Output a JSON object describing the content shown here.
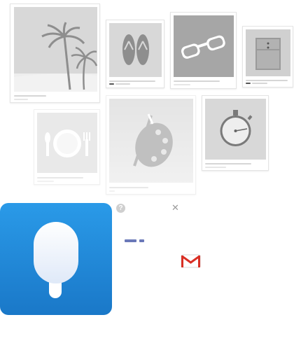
{
  "app": {
    "name": "Popsicle",
    "tile_color_top": "#2a9ae8",
    "tile_color_bottom": "#1a78c8",
    "icon": "popsicle-icon"
  },
  "popup": {
    "help_label": "?",
    "close_label": "✕",
    "help_icon": "question-circle-icon",
    "close_icon": "close-icon",
    "progress_color": "#6a78b8",
    "share_target": "gmail-icon"
  },
  "gallery": {
    "cards": [
      {
        "name": "beach-card",
        "icon": "palm-tree-icon"
      },
      {
        "name": "sandals-card",
        "icon": "flip-flops-icon"
      },
      {
        "name": "sunglasses-card",
        "icon": "sunglasses-icon"
      },
      {
        "name": "cabinet-card",
        "icon": "cabinet-icon"
      },
      {
        "name": "dining-card",
        "icon": "plate-fork-icon"
      },
      {
        "name": "art-card",
        "icon": "paint-palette-icon"
      },
      {
        "name": "stopwatch-card",
        "icon": "stopwatch-icon"
      }
    ]
  }
}
